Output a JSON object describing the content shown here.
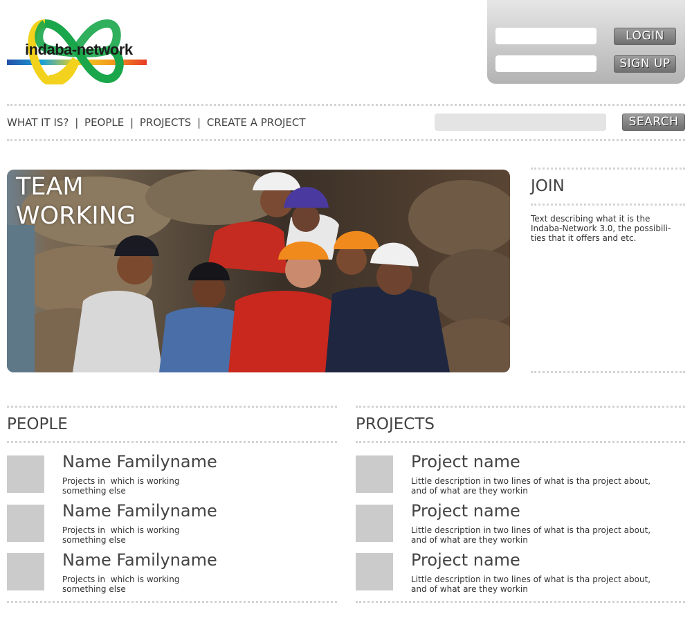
{
  "brand": {
    "logo_text": "indaba-network"
  },
  "login": {
    "login_label": "LOGIN",
    "signup_label": "SIGN UP"
  },
  "nav": {
    "items": [
      "WHAT IT IS?",
      "PEOPLE",
      "PROJECTS",
      "CREATE A PROJECT"
    ],
    "search_label": "SEARCH"
  },
  "hero": {
    "title_line1": "TEAM",
    "title_line2": "WORKING"
  },
  "join": {
    "title": "JOIN",
    "text": "Text describing what it is the Indaba-Network 3.0, the possibili- ties that it offers and etc."
  },
  "people": {
    "title": "PEOPLE",
    "items": [
      {
        "name": "Name Familyname",
        "desc_line1": "Projects in  which is working",
        "desc_line2": "something else"
      },
      {
        "name": "Name Familyname",
        "desc_line1": "Projects in  which is working",
        "desc_line2": "something else"
      },
      {
        "name": "Name Familyname",
        "desc_line1": "Projects in  which is working",
        "desc_line2": "something else"
      }
    ]
  },
  "projects": {
    "title": "PROJECTS",
    "items": [
      {
        "name": "Project name",
        "desc_line1": "Little description in two lines of what is tha project about,",
        "desc_line2": "and of what are they workin"
      },
      {
        "name": "Project name",
        "desc_line1": "Little description in two lines of what is tha project about,",
        "desc_line2": "and of what are they workin"
      },
      {
        "name": "Project name",
        "desc_line1": "Little description in two lines of what is tha project about,",
        "desc_line2": "and of what are they workin"
      }
    ]
  },
  "colors": {
    "logo_green": "#1aa64a",
    "logo_yellow": "#f2d21c",
    "logo_red": "#e83a25",
    "logo_blue": "#2450a8"
  }
}
